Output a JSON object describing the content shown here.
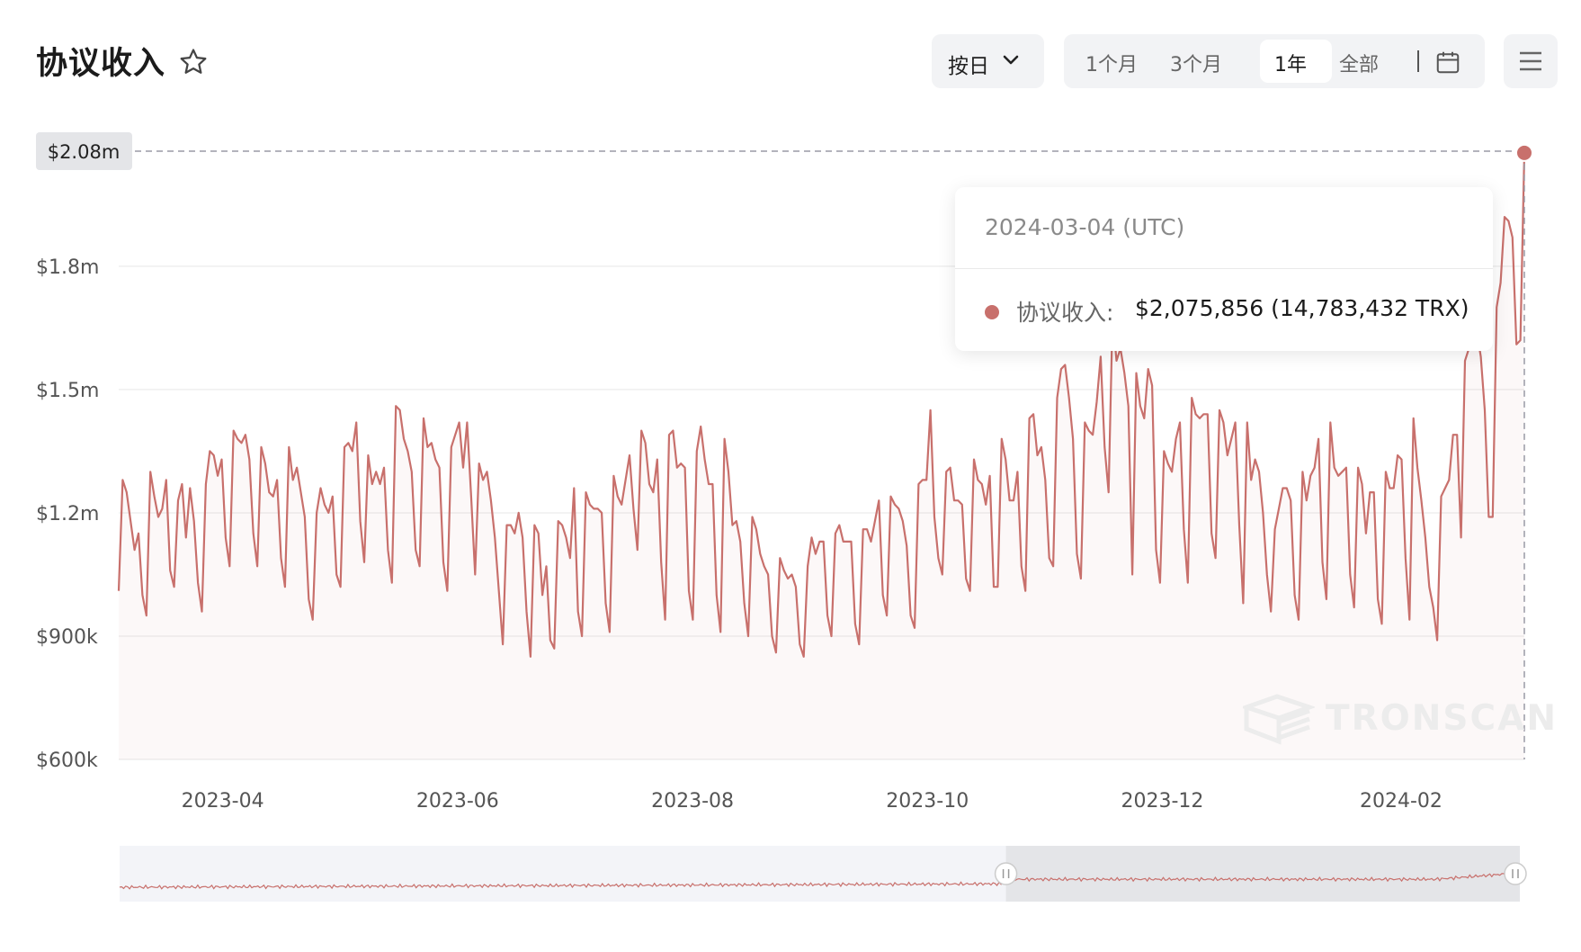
{
  "header": {
    "title": "协议收入",
    "granularity": "按日",
    "ranges": [
      "1个月",
      "3个月",
      "1年",
      "全部"
    ],
    "active_range": "1年"
  },
  "tooltip": {
    "date": "2024-03-04 (UTC)",
    "series_label": "协议收入:",
    "value": "$2,075,856 (14,783,432 TRX)"
  },
  "watermark": "TRONSCAN",
  "colors": {
    "line": "#c8706c",
    "accent_bg": "#f2f3f5"
  },
  "chart_data": {
    "type": "area",
    "x_start": "2023-03-05",
    "x_end": "2024-03-04",
    "ylim": [
      600000,
      2080000
    ],
    "yticks": [
      600000,
      900000,
      1200000,
      1500000,
      1800000
    ],
    "ytick_labels": [
      "$600k",
      "$900k",
      "$1.2m",
      "$1.5m",
      "$1.8m"
    ],
    "max_label": "$2.08m",
    "xtick_labels": [
      "2023-04",
      "2023-06",
      "2023-08",
      "2023-10",
      "2023-12",
      "2024-02"
    ],
    "xtick_dates": [
      "2023-04-01",
      "2023-06-01",
      "2023-08-01",
      "2023-10-01",
      "2023-12-01",
      "2024-02-01"
    ],
    "series": [
      {
        "values": [
          1010000,
          1280000,
          1250000,
          1180000,
          1110000,
          1150000,
          1000000,
          950000,
          1300000,
          1240000,
          1190000,
          1210000,
          1280000,
          1060000,
          1020000,
          1230000,
          1270000,
          1140000,
          1260000,
          1180000,
          1030000,
          960000,
          1270000,
          1350000,
          1340000,
          1290000,
          1330000,
          1140000,
          1070000,
          1400000,
          1380000,
          1370000,
          1390000,
          1330000,
          1150000,
          1070000,
          1360000,
          1320000,
          1250000,
          1240000,
          1280000,
          1090000,
          1020000,
          1360000,
          1280000,
          1310000,
          1250000,
          1190000,
          990000,
          940000,
          1200000,
          1260000,
          1220000,
          1200000,
          1240000,
          1050000,
          1020000,
          1360000,
          1370000,
          1350000,
          1420000,
          1180000,
          1080000,
          1340000,
          1270000,
          1300000,
          1270000,
          1310000,
          1110000,
          1030000,
          1460000,
          1450000,
          1380000,
          1350000,
          1300000,
          1110000,
          1070000,
          1430000,
          1360000,
          1370000,
          1330000,
          1310000,
          1080000,
          1010000,
          1360000,
          1390000,
          1420000,
          1310000,
          1420000,
          1240000,
          1050000,
          1320000,
          1280000,
          1300000,
          1230000,
          1140000,
          1010000,
          880000,
          1170000,
          1170000,
          1150000,
          1200000,
          1140000,
          960000,
          850000,
          1170000,
          1150000,
          1000000,
          1070000,
          890000,
          870000,
          1180000,
          1170000,
          1140000,
          1090000,
          1260000,
          960000,
          900000,
          1250000,
          1220000,
          1210000,
          1210000,
          1200000,
          980000,
          910000,
          1290000,
          1240000,
          1220000,
          1280000,
          1340000,
          1210000,
          1110000,
          1400000,
          1370000,
          1270000,
          1250000,
          1330000,
          1080000,
          940000,
          1390000,
          1400000,
          1310000,
          1320000,
          1310000,
          1010000,
          940000,
          1350000,
          1410000,
          1330000,
          1270000,
          1270000,
          1000000,
          910000,
          1380000,
          1300000,
          1170000,
          1180000,
          1130000,
          980000,
          900000,
          1190000,
          1160000,
          1100000,
          1070000,
          1050000,
          900000,
          860000,
          1090000,
          1060000,
          1040000,
          1050000,
          1020000,
          880000,
          850000,
          1070000,
          1140000,
          1100000,
          1130000,
          1130000,
          950000,
          900000,
          1150000,
          1170000,
          1130000,
          1130000,
          1130000,
          930000,
          880000,
          1160000,
          1160000,
          1130000,
          1180000,
          1230000,
          1000000,
          950000,
          1240000,
          1220000,
          1210000,
          1180000,
          1120000,
          950000,
          920000,
          1270000,
          1280000,
          1280000,
          1450000,
          1190000,
          1090000,
          1050000,
          1300000,
          1310000,
          1230000,
          1230000,
          1220000,
          1040000,
          1010000,
          1330000,
          1280000,
          1270000,
          1220000,
          1290000,
          1020000,
          1020000,
          1380000,
          1330000,
          1230000,
          1230000,
          1300000,
          1070000,
          1010000,
          1430000,
          1440000,
          1340000,
          1360000,
          1280000,
          1090000,
          1070000,
          1480000,
          1550000,
          1560000,
          1480000,
          1380000,
          1100000,
          1040000,
          1420000,
          1400000,
          1390000,
          1470000,
          1580000,
          1360000,
          1250000,
          1680000,
          1570000,
          1600000,
          1540000,
          1460000,
          1050000,
          1540000,
          1460000,
          1430000,
          1550000,
          1510000,
          1110000,
          1030000,
          1350000,
          1320000,
          1300000,
          1380000,
          1420000,
          1160000,
          1030000,
          1480000,
          1440000,
          1430000,
          1440000,
          1440000,
          1150000,
          1090000,
          1450000,
          1420000,
          1340000,
          1380000,
          1420000,
          1170000,
          980000,
          1420000,
          1280000,
          1330000,
          1300000,
          1200000,
          1050000,
          960000,
          1160000,
          1210000,
          1260000,
          1260000,
          1230000,
          1000000,
          940000,
          1300000,
          1230000,
          1290000,
          1310000,
          1380000,
          1080000,
          990000,
          1420000,
          1310000,
          1290000,
          1300000,
          1310000,
          1050000,
          970000,
          1310000,
          1270000,
          1150000,
          1250000,
          1250000,
          990000,
          930000,
          1300000,
          1260000,
          1260000,
          1340000,
          1330000,
          1090000,
          940000,
          1430000,
          1310000,
          1230000,
          1140000,
          1020000,
          970000,
          890000,
          1240000,
          1260000,
          1280000,
          1390000,
          1390000,
          1140000,
          1570000,
          1600000,
          1720000,
          1640000,
          1580000,
          1450000,
          1190000,
          1190000,
          1700000,
          1760000,
          1920000,
          1910000,
          1870000,
          1610000,
          1620000,
          2075856
        ]
      }
    ]
  }
}
